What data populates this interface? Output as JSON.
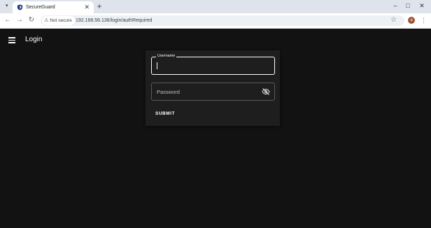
{
  "browser": {
    "tab_title": "SecureGuard",
    "security_label": "Not secure",
    "url": "192.168.56.136/login/authRequired",
    "profile_initial": "a"
  },
  "app": {
    "title": "Login"
  },
  "login_form": {
    "username_label": "Username",
    "username_value": "",
    "password_placeholder": "Password",
    "submit_label": "SUBMIT"
  }
}
